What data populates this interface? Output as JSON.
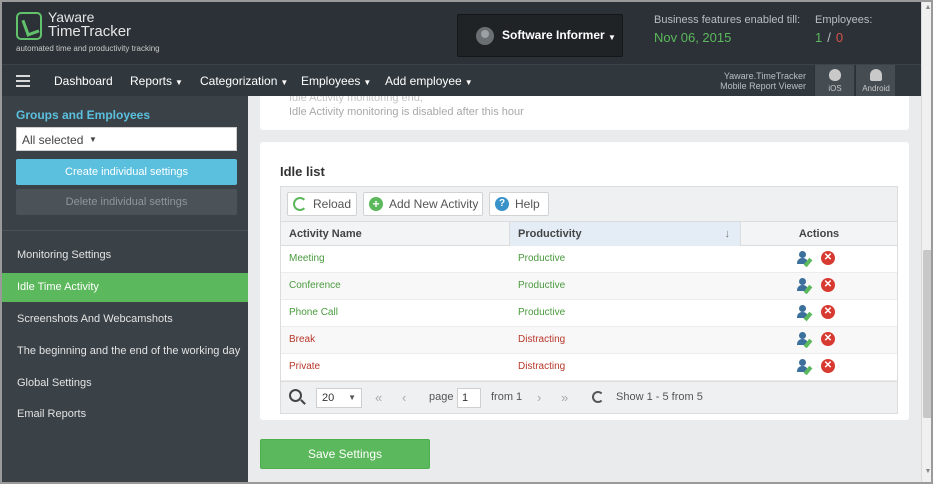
{
  "header": {
    "logo_line1": "Yaware",
    "logo_line2": "TimeTracker",
    "logo_tagline": "automated time and productivity tracking",
    "company_name": "Software Informer",
    "business_label": "Business features enabled till:",
    "business_date": "Nov 06, 2015",
    "employees_label": "Employees:",
    "employees_used": "1",
    "employees_sep": "/",
    "employees_total": "0"
  },
  "nav": {
    "items": [
      {
        "label": "Dashboard",
        "dropdown": false
      },
      {
        "label": "Reports",
        "dropdown": true
      },
      {
        "label": "Categorization",
        "dropdown": true
      },
      {
        "label": "Employees",
        "dropdown": true
      },
      {
        "label": "Add employee",
        "dropdown": true
      }
    ],
    "mobile_label_line1": "Yaware.TimeTracker",
    "mobile_label_line2": "Mobile Report Viewer",
    "ios_label": "iOS",
    "android_label": "Android"
  },
  "sidebar": {
    "groups_title": "Groups and Employees",
    "select_value": "All selected",
    "create_button": "Create individual settings",
    "delete_button": "Delete individual settings",
    "items": [
      {
        "label": "Monitoring Settings",
        "active": false
      },
      {
        "label": "Idle Time Activity",
        "active": true
      },
      {
        "label": "Screenshots And Webcamshots",
        "active": false
      },
      {
        "label": "The beginning and the end of the working day",
        "active": false
      },
      {
        "label": "Global Settings",
        "active": false
      },
      {
        "label": "Email Reports",
        "active": false
      }
    ]
  },
  "top_card": {
    "line1": "Idle Activity monitoring end,",
    "line2": "Idle Activity monitoring is disabled after this hour"
  },
  "idle_list": {
    "title": "Idle list",
    "toolbar": {
      "reload": "Reload",
      "add": "Add New Activity",
      "help": "Help"
    },
    "columns": {
      "name": "Activity Name",
      "productivity": "Productivity",
      "actions": "Actions",
      "sort_icon": "↓"
    },
    "rows": [
      {
        "name": "Meeting",
        "productivity": "Productive",
        "type": "productive"
      },
      {
        "name": "Conference",
        "productivity": "Productive",
        "type": "productive"
      },
      {
        "name": "Phone Call",
        "productivity": "Productive",
        "type": "productive"
      },
      {
        "name": "Break",
        "productivity": "Distracting",
        "type": "distracting"
      },
      {
        "name": "Private",
        "productivity": "Distracting",
        "type": "distracting"
      }
    ],
    "pager": {
      "page_size": "20",
      "page_label": "page",
      "page_value": "1",
      "from_label": "from 1",
      "summary": "Show 1 - 5 from 5"
    }
  },
  "save_button": "Save Settings",
  "colors": {
    "productive": "#4a9a3e",
    "distracting": "#b8372b",
    "accent_green": "#5cb85c",
    "accent_blue": "#5bc0de"
  }
}
